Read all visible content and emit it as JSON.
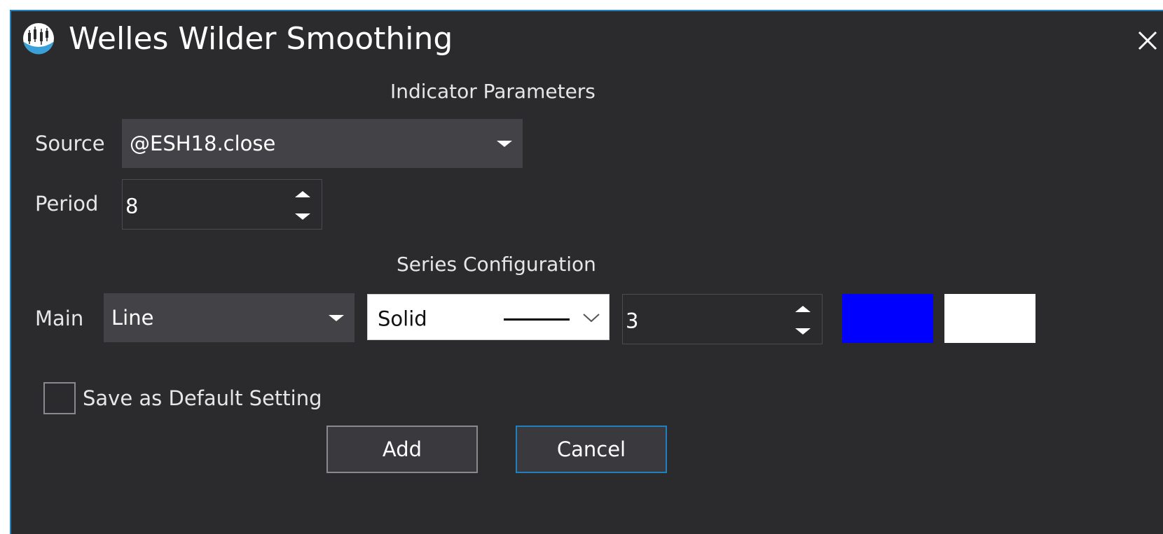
{
  "window": {
    "title": "Welles Wilder Smoothing",
    "close_glyph": "✕",
    "icon": "candlestick-chart-icon"
  },
  "indicator_parameters": {
    "heading": "Indicator Parameters",
    "source": {
      "label": "Source",
      "value": "@ESH18.close"
    },
    "period": {
      "label": "Period",
      "value": "8"
    }
  },
  "series_configuration": {
    "heading": "Series Configuration",
    "main": {
      "label": "Main",
      "plot_type": "Line",
      "line_style": "Solid",
      "line_width": "3",
      "color_primary": "#0000ff",
      "color_secondary": "#ffffff"
    }
  },
  "save_default": {
    "label": "Save as Default Setting",
    "checked": false
  },
  "buttons": {
    "add": "Add",
    "cancel": "Cancel"
  },
  "colors": {
    "dialog_bg": "#2b2b2d",
    "field_bg": "#434347",
    "accent_border": "#1f7fbf"
  }
}
